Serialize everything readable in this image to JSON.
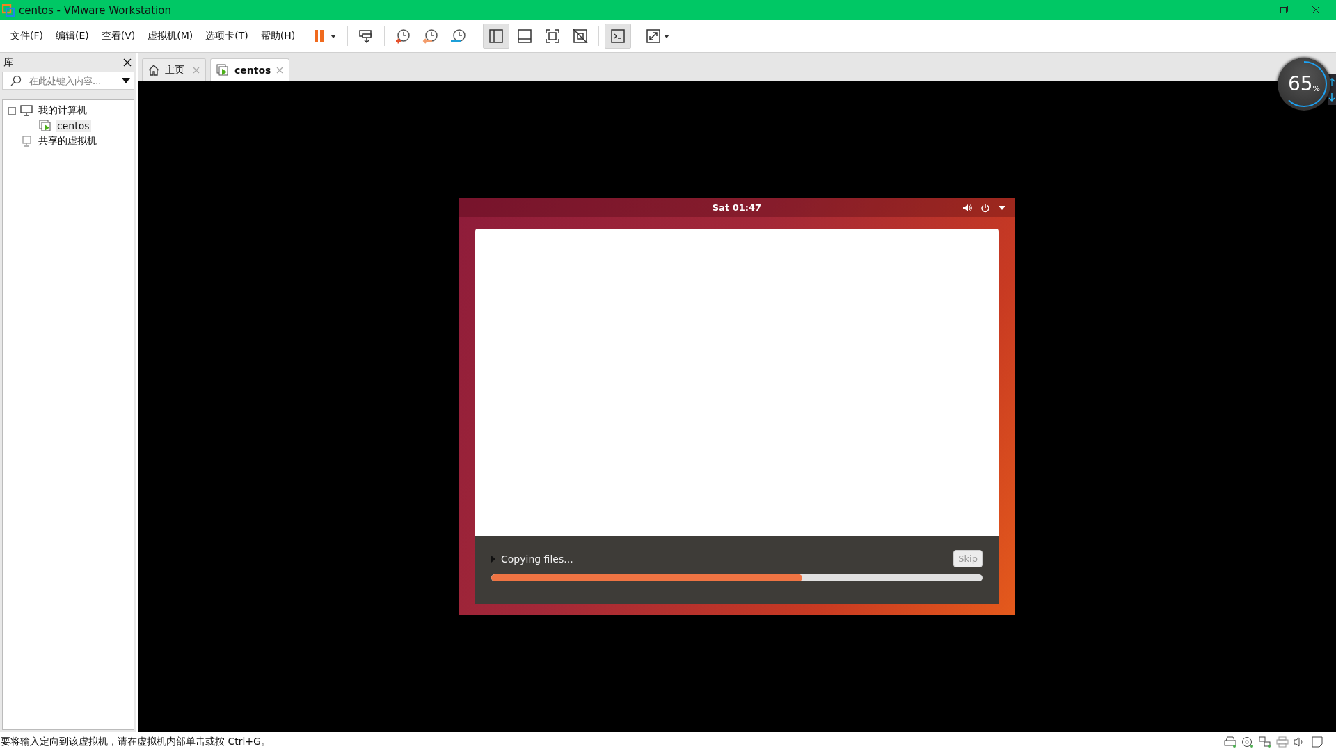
{
  "window": {
    "title": "centos - VMware Workstation"
  },
  "menu": [
    "文件(F)",
    "编辑(E)",
    "查看(V)",
    "虚拟机(M)",
    "选项卡(T)",
    "帮助(H)"
  ],
  "toolbar": [
    {
      "kind": "pause",
      "selected": false
    },
    {
      "kind": "send-keys",
      "selected": false
    },
    {
      "kind": "snapshot",
      "selected": false
    },
    {
      "kind": "revert",
      "selected": false
    },
    {
      "kind": "manage",
      "selected": false
    },
    {
      "kind": "sidebar",
      "selected": true
    },
    {
      "kind": "thumbs",
      "selected": false
    },
    {
      "kind": "fullscreen",
      "selected": false
    },
    {
      "kind": "unity",
      "selected": false
    },
    {
      "kind": "console",
      "selected": true
    },
    {
      "kind": "stretch",
      "selected": false
    }
  ],
  "library": {
    "title": "库",
    "search": {
      "placeholder": "在此处键入内容..."
    },
    "tree": [
      {
        "label": "我的计算机",
        "kind": "computer",
        "expanded": true,
        "selected": false,
        "children": [
          {
            "label": "centos",
            "kind": "vm",
            "selected": true
          }
        ]
      },
      {
        "label": "共享的虚拟机",
        "kind": "shared",
        "selected": false
      }
    ]
  },
  "tabs": [
    {
      "label": "主页",
      "kind": "home",
      "selected": false
    },
    {
      "label": "centos",
      "kind": "vm",
      "selected": true
    }
  ],
  "gauge": {
    "value": "65",
    "unit": "%"
  },
  "guest": {
    "clock": "Sat 01:47",
    "status": "Copying files...",
    "skip": "Skip",
    "progress": {
      "level": 0.633
    }
  },
  "status_bar": {
    "message": "要将输入定向到该虚拟机，请在虚拟机内部单击或按 Ctrl+G。"
  }
}
